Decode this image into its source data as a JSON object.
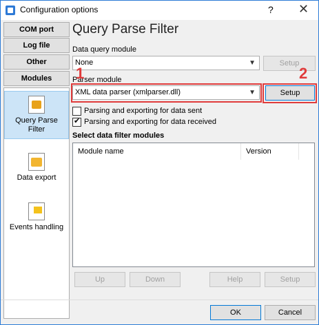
{
  "window": {
    "title": "Configuration options",
    "help_glyph": "?",
    "close_glyph": "✕"
  },
  "nav": {
    "buttons": [
      "COM port",
      "Log file",
      "Other",
      "Modules"
    ],
    "modules": [
      {
        "label": "Query Parse Filter",
        "icon": "puzzle-icon",
        "selected": true
      },
      {
        "label": "Data export",
        "icon": "export-icon",
        "selected": false
      },
      {
        "label": "Events handling",
        "icon": "events-icon",
        "selected": false
      }
    ]
  },
  "main": {
    "heading": "Query Parse Filter",
    "data_query_label": "Data query module",
    "data_query_value": "None",
    "setup_label": "Setup",
    "parser_label": "Parser module",
    "parser_value": "XML data parser (xmlparser.dll)",
    "check_sent_label": "Parsing and exporting for data sent",
    "check_sent": false,
    "check_received_label": "Parsing and exporting for data received",
    "check_received": true,
    "filter_title": "Select data filter modules",
    "columns": [
      "Module name",
      "Version"
    ],
    "rows": [],
    "buttons": {
      "up": "Up",
      "down": "Down",
      "help": "Help",
      "setup": "Setup"
    }
  },
  "footer": {
    "ok": "OK",
    "cancel": "Cancel"
  },
  "annotations": {
    "one": "1",
    "two": "2",
    "color": "#e03b3b"
  },
  "colors": {
    "accent": "#0078d7",
    "selection": "#cce4f7"
  }
}
